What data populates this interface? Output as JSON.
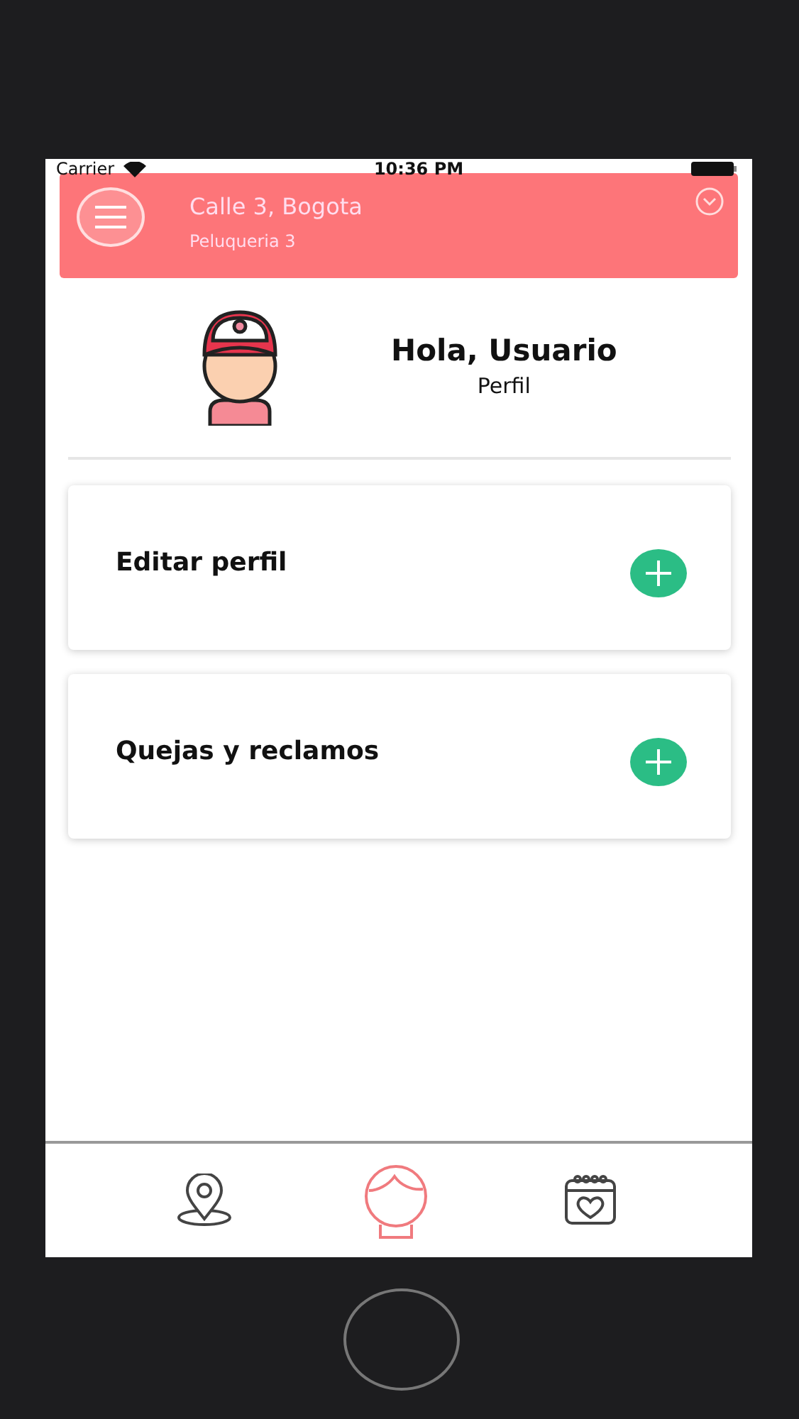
{
  "status_bar": {
    "carrier": "Carrier",
    "time": "10:36 PM"
  },
  "header": {
    "title": "Calle 3, Bogota",
    "subtitle": "Peluqueria 3"
  },
  "profile": {
    "greeting": "Hola, Usuario",
    "subtitle": "Perfil"
  },
  "cards": [
    {
      "label": "Editar perfil"
    },
    {
      "label": "Quejas y reclamos"
    }
  ],
  "tabs": [
    {
      "kind": "location",
      "selected": false
    },
    {
      "kind": "profile",
      "selected": true
    },
    {
      "kind": "calendar",
      "selected": false
    }
  ]
}
